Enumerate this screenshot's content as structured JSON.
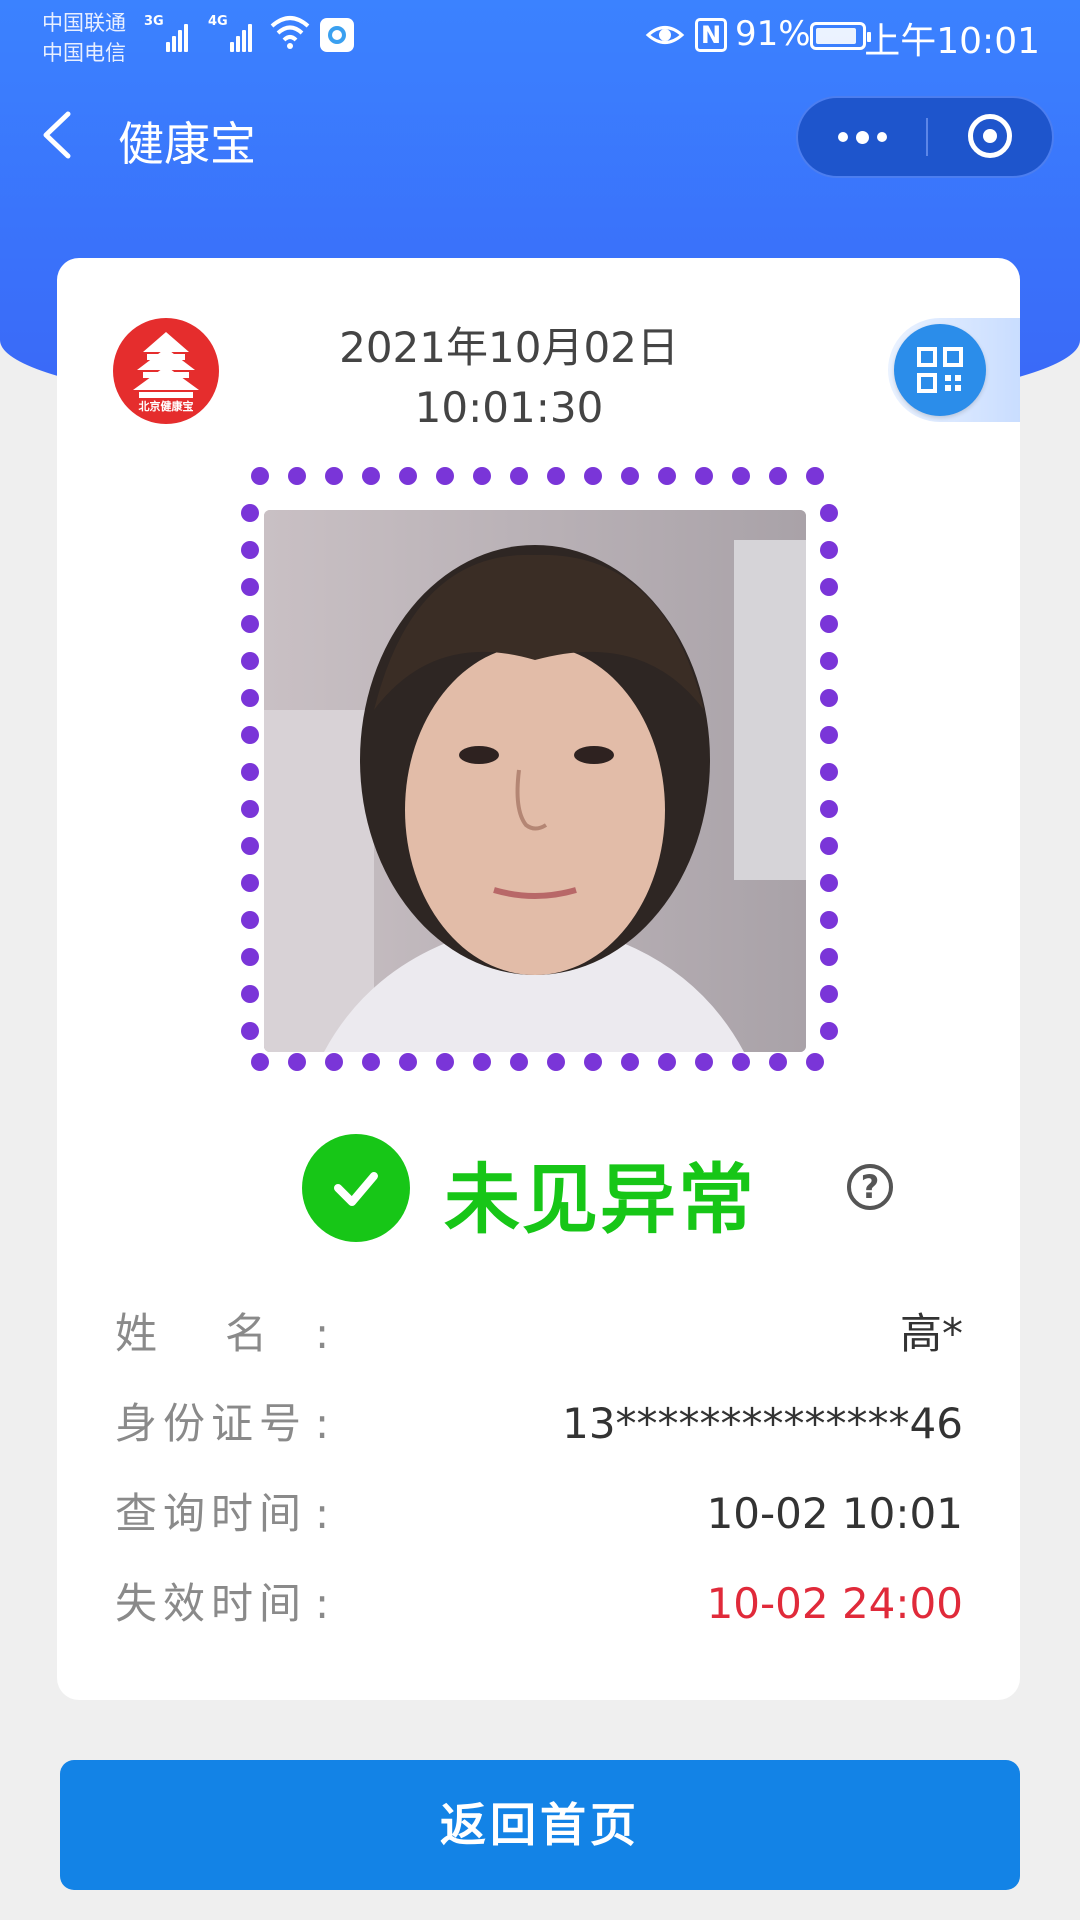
{
  "status_bar": {
    "carrier_1": "中国联通",
    "carrier_2": "中国电信",
    "network_1": "3G",
    "network_2": "4G",
    "battery_percent": "91%",
    "battery_level": 0.91,
    "clock": "上午10:01",
    "icons": [
      "signal-icon",
      "wifi-icon",
      "app-notification-icon",
      "eye-comfort-icon",
      "nfc-icon",
      "battery-icon"
    ]
  },
  "nav": {
    "back_icon": "chevron-left-icon",
    "title": "健康宝",
    "more_icon": "more-dots-icon",
    "close_icon": "target-close-icon"
  },
  "card": {
    "logo_text": "北京健康宝",
    "date": "2021年10月02日",
    "time": "10:01:30",
    "qr_icon": "qr-code-icon",
    "frame_color": "#7a35d8",
    "status_text": "未见异常",
    "status_color": "#17c617",
    "help_symbol": "?",
    "fields": [
      {
        "label": "姓名",
        "colon": ":",
        "value": "高*"
      },
      {
        "label": "身份证号",
        "colon": ":",
        "value": "13**************46"
      },
      {
        "label": "查询时间",
        "colon": ":",
        "value": "10-02 10:01"
      },
      {
        "label": "失效时间",
        "colon": ":",
        "value": "10-02 24:00",
        "value_color": "#e02a3a"
      }
    ]
  },
  "home_button": {
    "label": "返回首页"
  },
  "colors": {
    "header_blue": "#3b82ff",
    "button_blue": "#1383e6"
  }
}
